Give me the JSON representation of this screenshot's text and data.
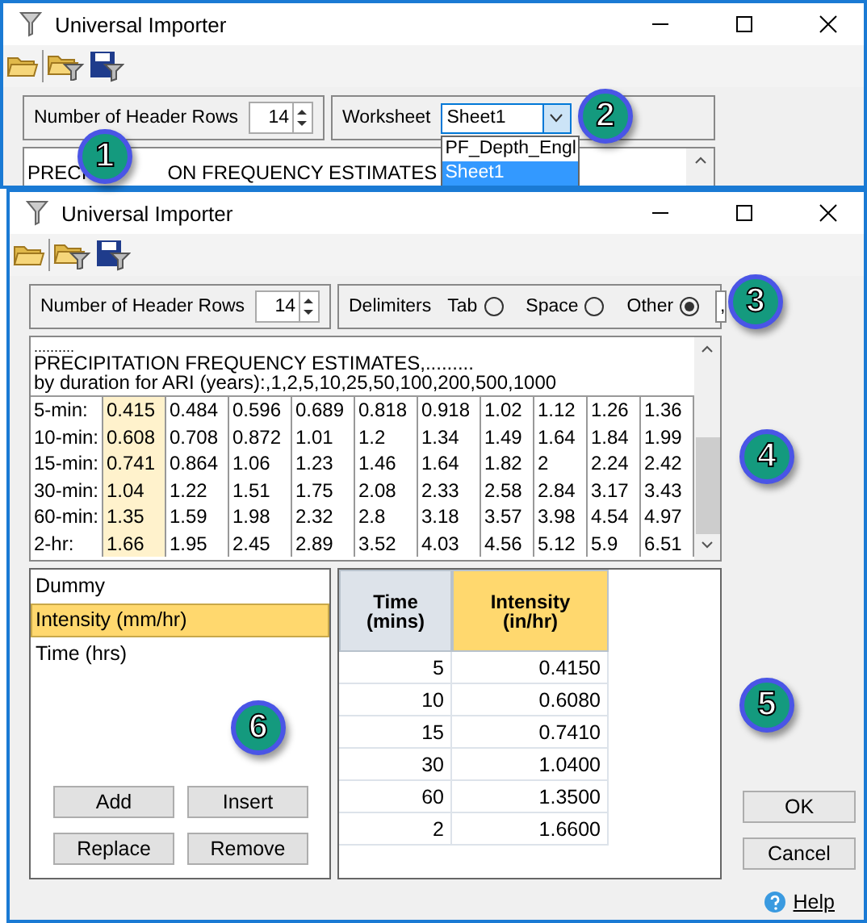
{
  "back_window": {
    "title": "Universal Importer",
    "header_rows": {
      "label": "Number of Header Rows",
      "value": "14"
    },
    "worksheet": {
      "label": "Worksheet",
      "value": "Sheet1",
      "expanded": true,
      "options": [
        {
          "label": "PF_Depth_Engl",
          "selected": false
        },
        {
          "label": "Sheet1",
          "selected": true
        }
      ]
    },
    "preview_fragments": [
      "PRECI",
      "ON FREQUENCY ESTIMATES"
    ]
  },
  "front_window": {
    "title": "Universal Importer",
    "header_rows": {
      "label": "Number of Header Rows",
      "value": "14"
    },
    "delimiters": {
      "label": "Delimiters",
      "options": [
        {
          "label": "Tab",
          "selected": false
        },
        {
          "label": "Space",
          "selected": false
        },
        {
          "label": "Other",
          "selected": true
        }
      ],
      "other_value": ","
    },
    "preview": {
      "lines": [
        "..........",
        "PRECIPITATION FREQUENCY ESTIMATES,.........",
        "by duration for ARI (years):,1,2,5,10,25,50,100,200,500,1000"
      ],
      "columns": [
        {
          "selected": false
        },
        {
          "selected": true
        },
        {
          "selected": false
        },
        {
          "selected": false
        },
        {
          "selected": false
        },
        {
          "selected": false
        },
        {
          "selected": false
        },
        {
          "selected": false
        },
        {
          "selected": false
        },
        {
          "selected": false
        },
        {
          "selected": false
        }
      ],
      "rows": [
        [
          "5-min:",
          "0.415",
          "0.484",
          "0.596",
          "0.689",
          "0.818",
          "0.918",
          "1.02",
          "1.12",
          "1.26",
          "1.36"
        ],
        [
          "10-min:",
          "0.608",
          "0.708",
          "0.872",
          "1.01",
          "1.2",
          "1.34",
          "1.49",
          "1.64",
          "1.84",
          "1.99"
        ],
        [
          "15-min:",
          "0.741",
          "0.864",
          "1.06",
          "1.23",
          "1.46",
          "1.64",
          "1.82",
          "2",
          "2.24",
          "2.42"
        ],
        [
          "30-min:",
          "1.04",
          "1.22",
          "1.51",
          "1.75",
          "2.08",
          "2.33",
          "2.58",
          "2.84",
          "3.17",
          "3.43"
        ],
        [
          "60-min:",
          "1.35",
          "1.59",
          "1.98",
          "2.32",
          "2.8",
          "3.18",
          "3.57",
          "3.98",
          "4.54",
          "4.97"
        ],
        [
          "2-hr:",
          "1.66",
          "1.95",
          "2.45",
          "2.89",
          "3.52",
          "4.03",
          "4.56",
          "5.12",
          "5.9",
          "6.51"
        ]
      ]
    },
    "fields": [
      {
        "label": "Dummy",
        "selected": false
      },
      {
        "label": "Intensity (mm/hr)",
        "selected": true
      },
      {
        "label": "Time (hrs)",
        "selected": false
      }
    ],
    "field_buttons": [
      "Add",
      "Insert",
      "Replace",
      "Remove"
    ],
    "grid": {
      "columns": [
        {
          "label_lines": [
            "Time",
            "(mins)"
          ],
          "selected": false
        },
        {
          "label_lines": [
            "Intensity",
            "(in/hr)"
          ],
          "selected": true
        }
      ],
      "rows": [
        [
          "5",
          "0.4150"
        ],
        [
          "10",
          "0.6080"
        ],
        [
          "15",
          "0.7410"
        ],
        [
          "30",
          "1.0400"
        ],
        [
          "60",
          "1.3500"
        ],
        [
          "2",
          "1.6600"
        ]
      ]
    },
    "buttons": [
      "OK",
      "Cancel"
    ],
    "help": "Help"
  },
  "callouts": [
    "1",
    "2",
    "3",
    "4",
    "5",
    "6"
  ]
}
